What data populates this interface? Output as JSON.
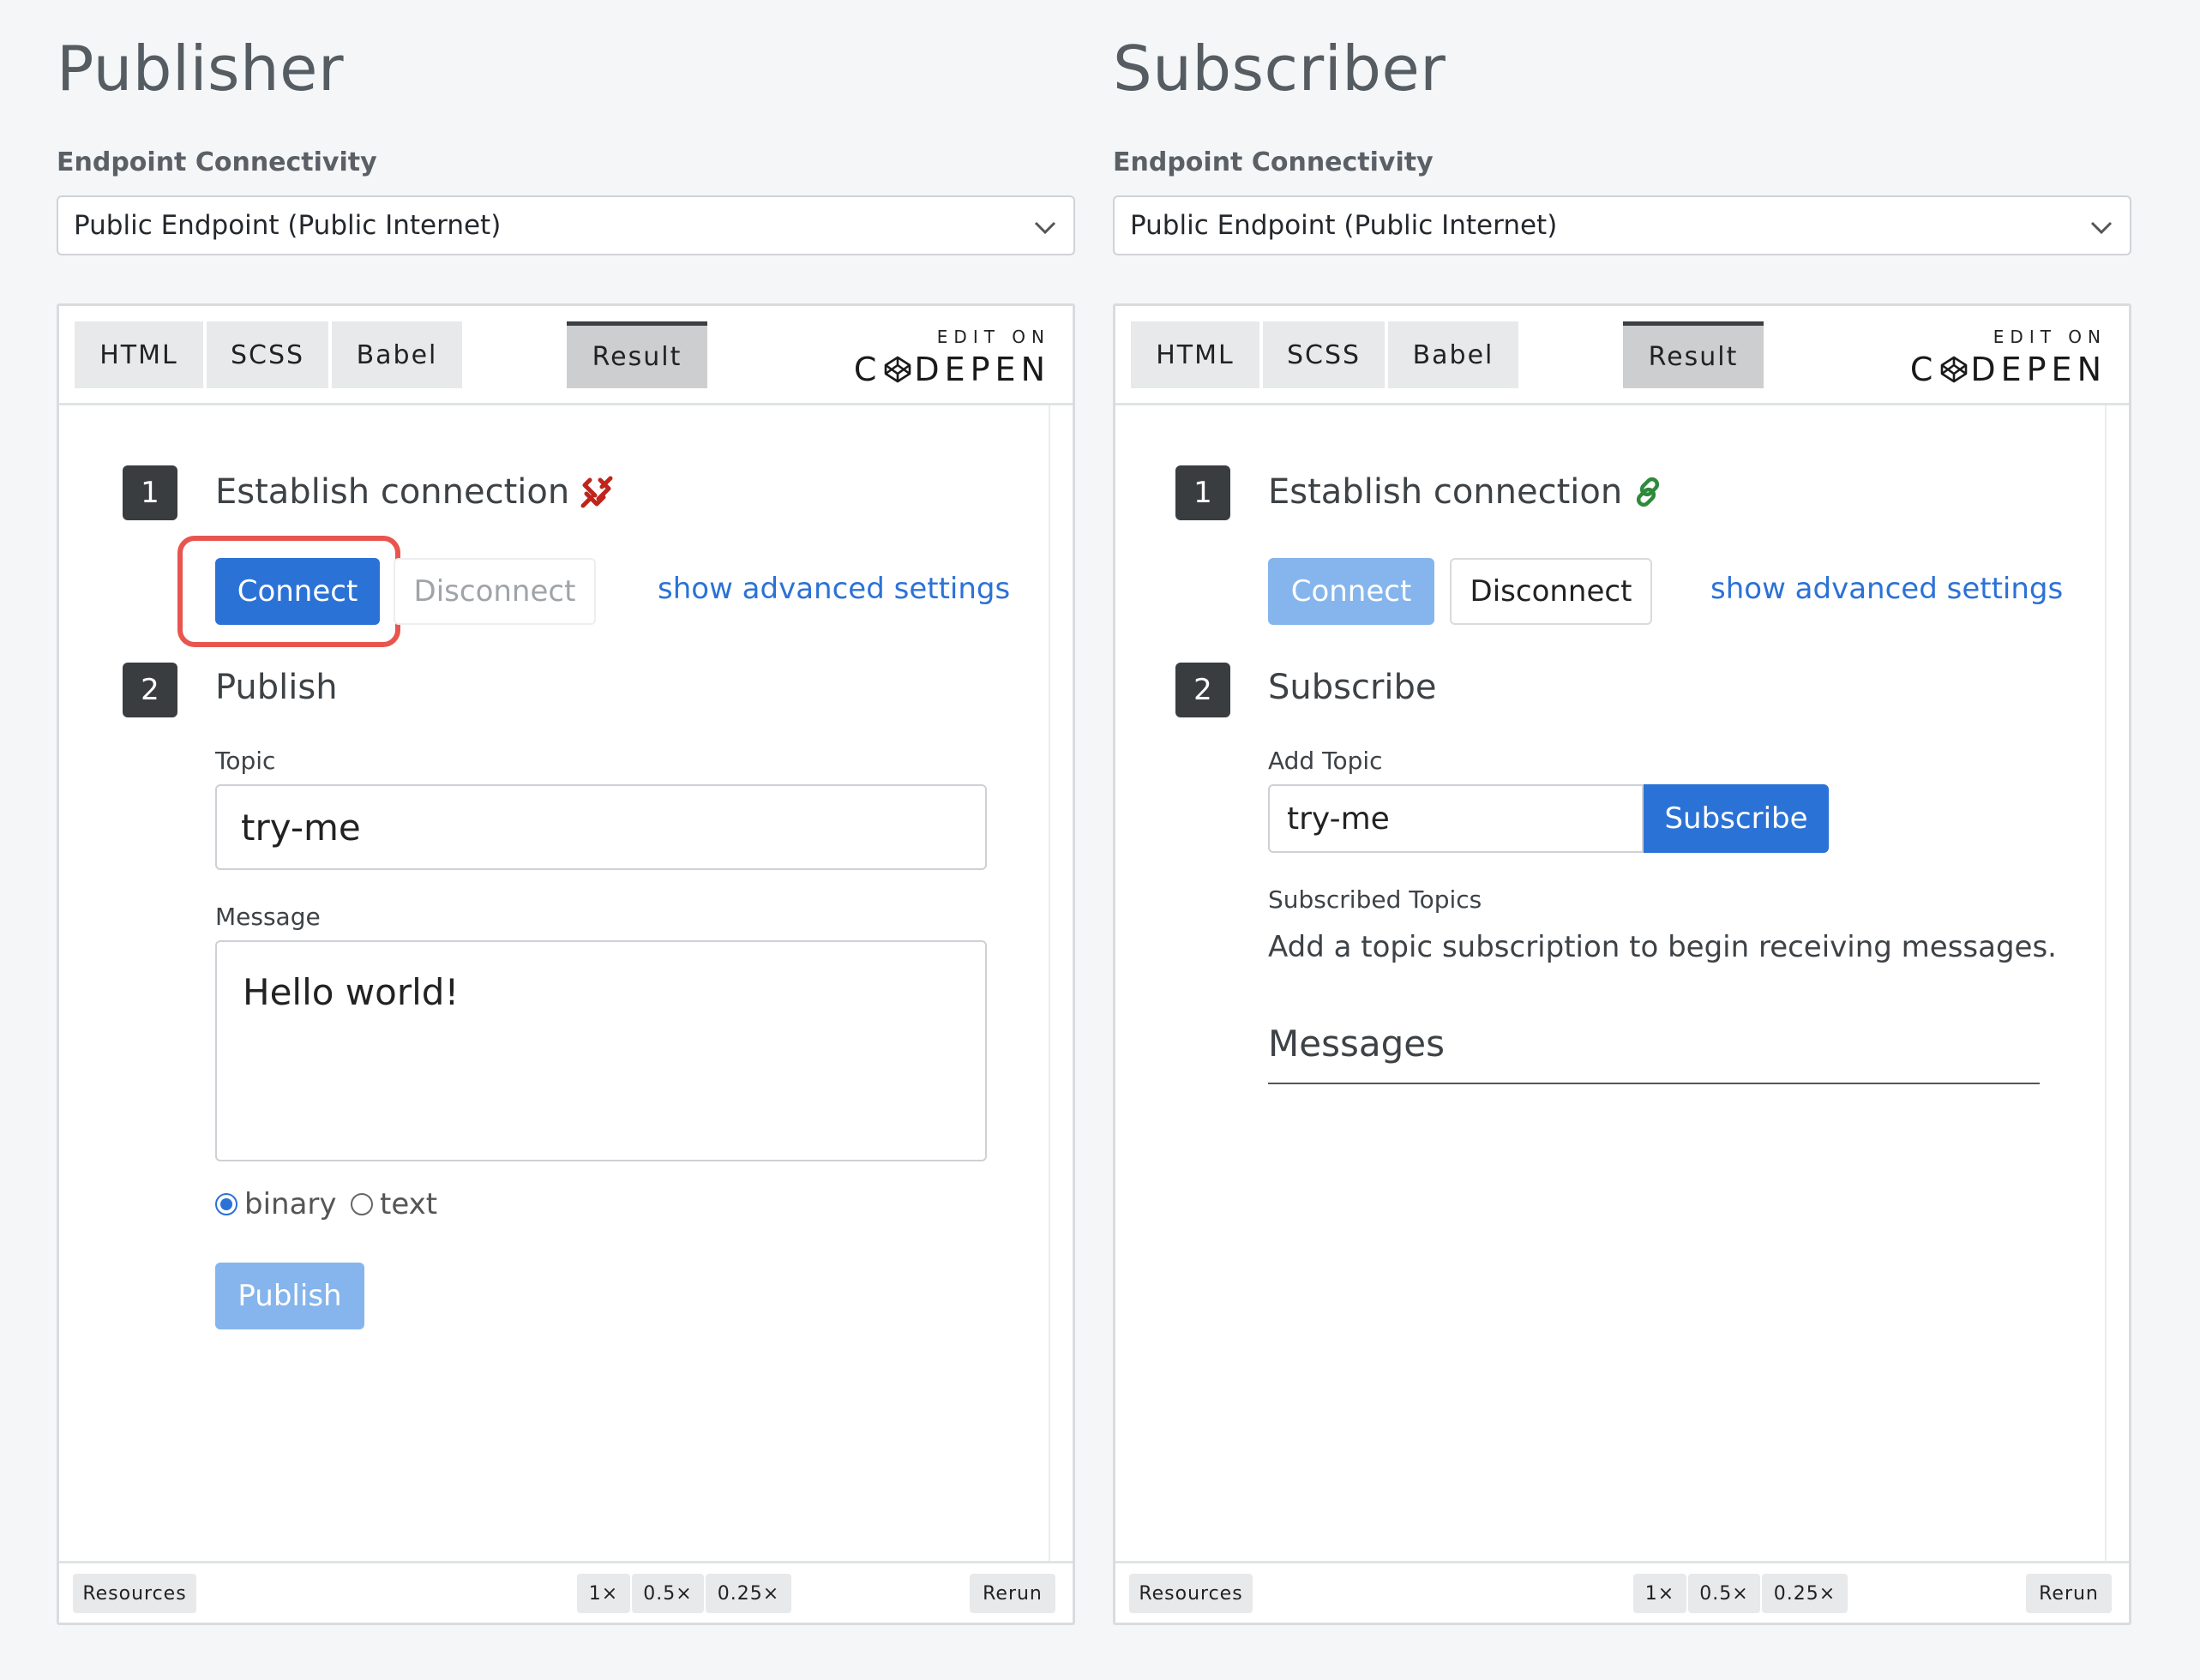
{
  "publisher": {
    "heading": "Publisher",
    "endpoint_label": "Endpoint Connectivity",
    "endpoint_value": "Public Endpoint  (Public Internet)",
    "tabs": {
      "html": "HTML",
      "scss": "SCSS",
      "babel": "Babel",
      "result": "Result"
    },
    "edit_on": "EDIT ON",
    "codepen_left": "C",
    "codepen_right": "DEPEN",
    "step1": {
      "number": "1",
      "title": "Establish connection",
      "status_icon": "broken-link-icon",
      "status_color": "#c0241b"
    },
    "connect_label": "Connect",
    "disconnect_label": "Disconnect",
    "advanced_link": "show advanced settings",
    "step2": {
      "number": "2",
      "title": "Publish"
    },
    "topic_label": "Topic",
    "topic_value": "try-me",
    "message_label": "Message",
    "message_value": "Hello world!",
    "format_binary": "binary",
    "format_text": "text",
    "publish_label": "Publish",
    "footer": {
      "resources": "Resources",
      "z1": "1×",
      "z05": "0.5×",
      "z025": "0.25×",
      "rerun": "Rerun"
    }
  },
  "subscriber": {
    "heading": "Subscriber",
    "endpoint_label": "Endpoint Connectivity",
    "endpoint_value": "Public Endpoint  (Public Internet)",
    "tabs": {
      "html": "HTML",
      "scss": "SCSS",
      "babel": "Babel",
      "result": "Result"
    },
    "edit_on": "EDIT ON",
    "codepen_left": "C",
    "codepen_right": "DEPEN",
    "step1": {
      "number": "1",
      "title": "Establish connection",
      "status_icon": "link-icon",
      "status_color": "#2e8a3a"
    },
    "connect_label": "Connect",
    "disconnect_label": "Disconnect",
    "advanced_link": "show advanced settings",
    "step2": {
      "number": "2",
      "title": "Subscribe"
    },
    "add_topic_label": "Add Topic",
    "add_topic_value": "try-me",
    "subscribe_label": "Subscribe",
    "subscribed_topics_label": "Subscribed Topics",
    "empty_text": "Add a topic subscription to begin receiving messages.",
    "messages_title": "Messages",
    "footer": {
      "resources": "Resources",
      "z1": "1×",
      "z05": "0.5×",
      "z025": "0.25×",
      "rerun": "Rerun"
    }
  },
  "colors": {
    "accent": "#2b72d6",
    "highlight": "#e8554e",
    "background": "#f5f6f8"
  }
}
